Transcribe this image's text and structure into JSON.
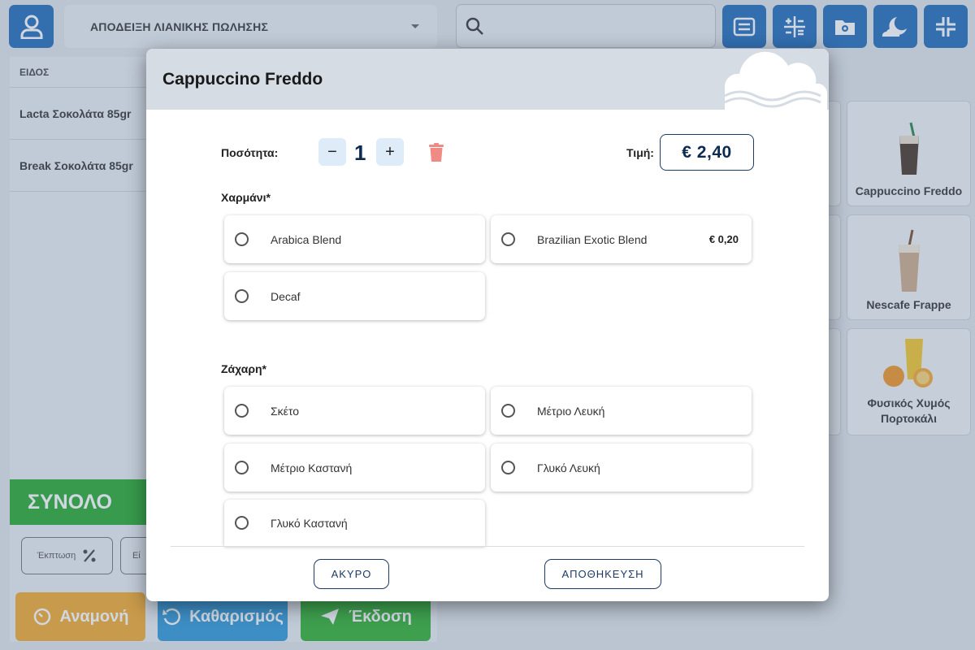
{
  "header": {
    "document_type": "ΑΠΟΔΕΙΞΗ ΛΙΑΝΙΚΗΣ ΠΩΛΗΣΗΣ",
    "search_placeholder": ""
  },
  "order_list": {
    "column_header": "ΕΙΔΟΣ",
    "items": [
      {
        "name": "Lacta Σοκολάτα 85gr"
      },
      {
        "name": "Break Σοκολάτα 85gr"
      }
    ]
  },
  "totals": {
    "total_label": "ΣΥΝΟΛΟ",
    "discount_label": "Έκπτωση",
    "second_button_label": "Εί"
  },
  "actions": {
    "hold_label": "Αναμονή",
    "clear_label": "Καθαρισμός",
    "issue_label": "Έκδοση"
  },
  "products": [
    {
      "name": "Cappuccino Freddo"
    },
    {
      "name": "Nescafe Frappe"
    },
    {
      "name": "Φυσικός Χυμός Πορτοκάλι"
    }
  ],
  "modal": {
    "title": "Cappuccino Freddo",
    "quantity_label": "Ποσότητα:",
    "quantity": "1",
    "minus_label": "−",
    "plus_label": "+",
    "price_label": "Τιμή:",
    "price": "€ 2,40",
    "groups": [
      {
        "title": "Χαρμάνι*",
        "options": [
          {
            "label": "Arabica Blend",
            "price": ""
          },
          {
            "label": "Brazilian Exotic Blend",
            "price": "€ 0,20"
          },
          {
            "label": "Decaf",
            "price": ""
          }
        ]
      },
      {
        "title": "Ζάχαρη*",
        "options": [
          {
            "label": "Σκέτο",
            "price": ""
          },
          {
            "label": "Μέτριο Λευκή",
            "price": ""
          },
          {
            "label": "Μέτριο Καστανή",
            "price": ""
          },
          {
            "label": "Γλυκό Λευκή",
            "price": ""
          },
          {
            "label": "Γλυκό Καστανή",
            "price": ""
          }
        ]
      }
    ],
    "cancel_label": "ΑΚΥΡΟ",
    "save_label": "ΑΠΟΘΗΚΕΥΣΗ"
  },
  "colors": {
    "primary_blue": "#0f5fb4",
    "total_green": "#16a21d",
    "hold_orange": "#f3a21b",
    "clear_blue": "#1e8fd6",
    "issue_green": "#1faa1f",
    "price_navy": "#0c2a52",
    "delete_red": "#f08a84"
  },
  "icons": [
    "user-icon",
    "search-icon",
    "receipt-icon",
    "calculator-icon",
    "settings-folder-icon",
    "night-mode-icon",
    "collapse-icon",
    "discount-percent-icon",
    "timer-icon",
    "undo-icon",
    "send-icon",
    "trash-icon",
    "cloud-icon"
  ]
}
